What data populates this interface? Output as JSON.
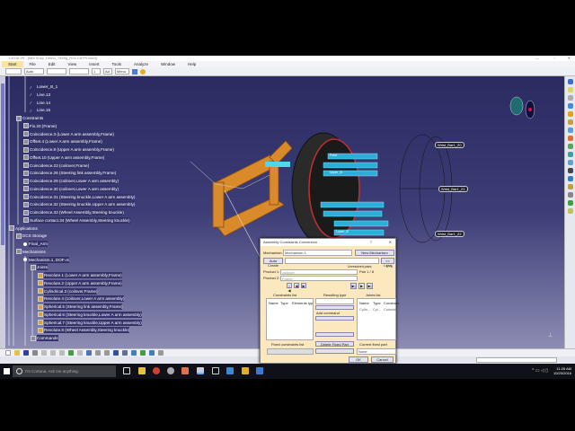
{
  "window": {
    "title": "CATIA V5 - [MM Susp_Demo_7548g_R24.CATProduct]",
    "controls": [
      "—",
      "▫",
      "✕"
    ]
  },
  "menu": [
    "Start",
    "File",
    "Edit",
    "View",
    "Insert",
    "Tools",
    "Analyze",
    "Window",
    "Help"
  ],
  "toolbar": {
    "combo1": "",
    "combo2": "Auto",
    "combo3": "",
    "combo4": "",
    "combo5": "1",
    "combo6": "Ad",
    "combo7": "Menu"
  },
  "tree": [
    {
      "label": "Lower_B_1",
      "depth": 4,
      "kind": "line"
    },
    {
      "label": "Line.13",
      "depth": 4,
      "kind": "line"
    },
    {
      "label": "Line.14",
      "depth": 4,
      "kind": "line"
    },
    {
      "label": "Line.15",
      "depth": 4,
      "kind": "line"
    },
    {
      "label": "Constraints",
      "depth": 2,
      "kind": "folder"
    },
    {
      "label": "Fix.20 (Frame)",
      "depth": 3,
      "kind": "c"
    },
    {
      "label": "Coincidence.3 (Lower A arm assembly,Frame)",
      "depth": 3,
      "kind": "c"
    },
    {
      "label": "Offset.4 (Lower A arm assembly,Frame)",
      "depth": 3,
      "kind": "c"
    },
    {
      "label": "Coincidence.8 (Upper A arm assembly,Frame)",
      "depth": 3,
      "kind": "c"
    },
    {
      "label": "Offset.10 (Upper A arm assembly,Frame)",
      "depth": 3,
      "kind": "c"
    },
    {
      "label": "Coincidence.23 (coilover,Frame)",
      "depth": 3,
      "kind": "c"
    },
    {
      "label": "Coincidence.26 (Steering link assembly,Frame)",
      "depth": 3,
      "kind": "c"
    },
    {
      "label": "Coincidence.29 (coilover,Lower A arm assembly)",
      "depth": 3,
      "kind": "c"
    },
    {
      "label": "Coincidence.30 (coilover,Lower A arm assembly)",
      "depth": 3,
      "kind": "c"
    },
    {
      "label": "Coincidence.31 (Steering knuckle,Lower A arm assembly)",
      "depth": 3,
      "kind": "c"
    },
    {
      "label": "Coincidence.32 (Steering knuckle,Upper A arm assembly)",
      "depth": 3,
      "kind": "c"
    },
    {
      "label": "Coincidence.33 (Wheel Assembly,Steering knuckle)",
      "depth": 3,
      "kind": "c"
    },
    {
      "label": "Surface contact.34 (Wheel Assembly,Steering knuckle)",
      "depth": 3,
      "kind": "c"
    },
    {
      "label": "Applications",
      "depth": 1,
      "kind": "folder"
    },
    {
      "label": "DCS Storage",
      "depth": 2,
      "kind": "folder"
    },
    {
      "label": "Final_Arm",
      "depth": 3,
      "kind": "node"
    },
    {
      "label": "Mechanisms",
      "depth": 2,
      "kind": "folder"
    },
    {
      "label": "Mechanism.1, DOF=5",
      "depth": 3,
      "kind": "node"
    },
    {
      "label": "Joints",
      "depth": 4,
      "kind": "folder"
    },
    {
      "label": "Revolute.1 (Lower A arm assembly,Frame)",
      "depth": 5,
      "kind": "j"
    },
    {
      "label": "Revolute.2 (Upper A arm assembly,Frame)",
      "depth": 5,
      "kind": "j"
    },
    {
      "label": "Cylindrical.3 (coilover,Frame)",
      "depth": 5,
      "kind": "j"
    },
    {
      "label": "Revolute.4 (coilover,Lower A arm assembly)",
      "depth": 5,
      "kind": "j"
    },
    {
      "label": "Spherical.5 (Steering link assembly,Frame)",
      "depth": 5,
      "kind": "j"
    },
    {
      "label": "Spherical.6 (Steering knuckle,Lower A arm assembly)",
      "depth": 5,
      "kind": "j"
    },
    {
      "label": "Spherical.7 (Steering knuckle,Upper A arm assembly)",
      "depth": 5,
      "kind": "j"
    },
    {
      "label": "Revolute.8 (Wheel Assembly,Steering knuckle)",
      "depth": 5,
      "kind": "j"
    },
    {
      "label": "Commands",
      "depth": 4,
      "kind": "folder"
    }
  ],
  "model_labels": {
    "tags": [
      "Wrist_Bar1_Z0",
      "Wrist_Bar1_Z1",
      "Wrist_Bar1_Z2"
    ],
    "bar": "Bar1_Z0",
    "wheel_tags": [
      "Point",
      "Upper_B",
      "Lower_B"
    ]
  },
  "dialog": {
    "title": "Assembly Constraints Conversion",
    "help": "?",
    "close": "✕",
    "mechanism_label": "Mechanism:",
    "mechanism_value": "Mechanism.1",
    "new_mechanism": "New Mechanism",
    "auto_create": "Auto Create",
    "less": "<< Less",
    "unresolved_label": "Unresolved pairs:",
    "unresolved_value": "8 / 8",
    "product1_label": "Product 1:",
    "product1_value": "coilover",
    "product2_label": "Product 2:",
    "product2_value": "Frame",
    "pair": "Pair 1 / 8",
    "constraints_list": "Constraints list",
    "constraints_cols": [
      "Name",
      "Type",
      "Elements typ"
    ],
    "resulting_type": "Resulting type",
    "add_command": "Add command",
    "joints_list": "Joints list",
    "joints_cols": [
      "Name",
      "Type",
      "Constrain"
    ],
    "joints_row": [
      "Cylin...",
      "Cyl...",
      "Coincide..."
    ],
    "fixed_list": "Fixed constraints list",
    "delete_fixed": "Delete Fixed Part",
    "current_fixed": "Current fixed part",
    "current_fixed_value": "None",
    "ok": "OK",
    "cancel": "Cancel"
  },
  "taskbar": {
    "search": "I'm Cortana. Ask me anything.",
    "time": "11:26 AM",
    "date": "10/20/2016"
  }
}
